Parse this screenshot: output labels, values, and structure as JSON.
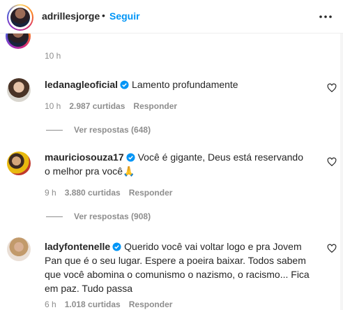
{
  "header": {
    "username": "adrillesjorge",
    "separator": "•",
    "follow_label": "Seguir"
  },
  "first_item": {
    "time": "10 h"
  },
  "comments": [
    {
      "username": "ledanagleoficial",
      "text": "Lamento profundamente",
      "time": "10 h",
      "likes": "2.987 curtidas",
      "reply_label": "Responder",
      "view_replies": "Ver respostas (648)"
    },
    {
      "username": "mauriciosouza17",
      "text": "Você é gigante, Deus está reservando o melhor pra você🙏",
      "time": "9 h",
      "likes": "3.880 curtidas",
      "reply_label": "Responder",
      "view_replies": "Ver respostas (908)"
    },
    {
      "username": "ladyfontenelle",
      "text": "Querido você vai voltar logo e pra Jovem Pan que é o seu lugar. Espere a poeira baixar. Todos sabem que você abomina o comunismo o nazismo, o racismo... Fica em paz. Tudo passa",
      "time": "6 h",
      "likes": "1.018 curtidas",
      "reply_label": "Responder"
    }
  ],
  "colors": {
    "link": "#0095f6",
    "muted": "#8e8e8e",
    "text": "#262626",
    "verified": "#0095f6"
  },
  "icons": [
    "more-options-icon",
    "verified-badge-icon",
    "heart-icon"
  ]
}
